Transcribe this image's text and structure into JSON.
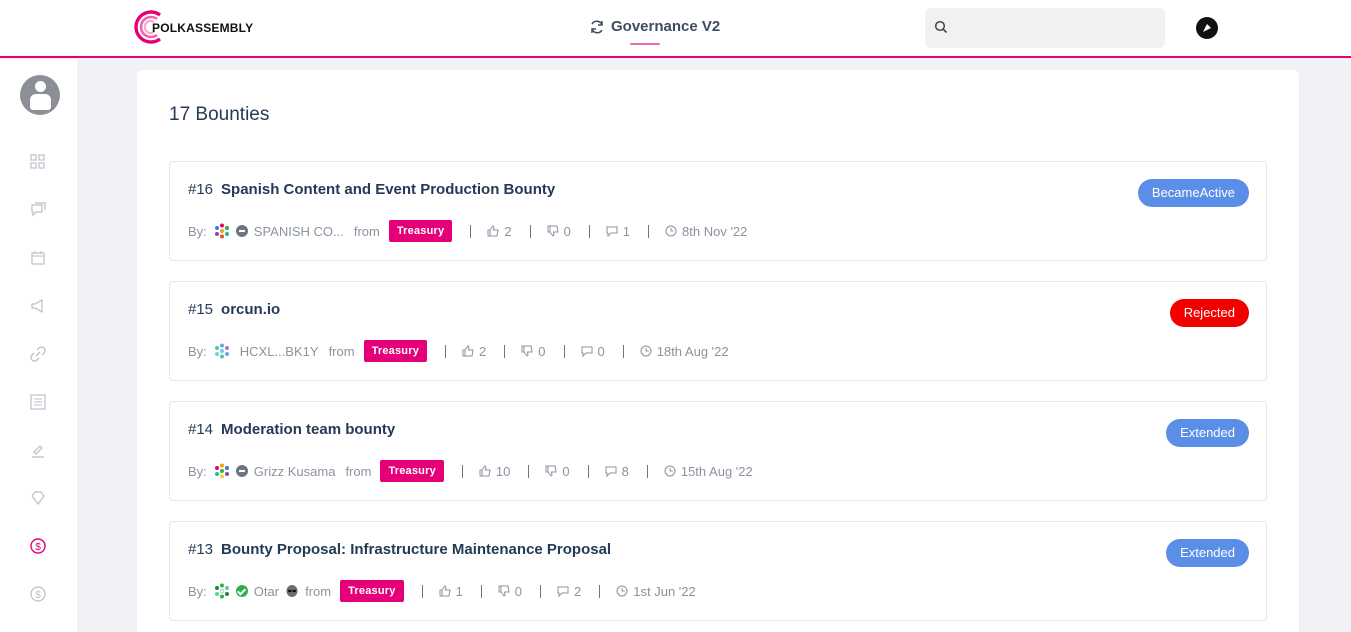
{
  "header": {
    "logo_text": "POLKASSEMBLY",
    "network_label": "Governance V2",
    "search_placeholder": ""
  },
  "sidebar": {
    "items": [
      {
        "icon": "grid-icon"
      },
      {
        "icon": "discussions-icon"
      },
      {
        "icon": "calendar-icon"
      },
      {
        "icon": "megaphone-icon"
      },
      {
        "icon": "link-icon"
      },
      {
        "icon": "list-icon"
      },
      {
        "icon": "gavel-icon"
      },
      {
        "icon": "diamond-icon"
      },
      {
        "icon": "bounty-icon",
        "active": true
      },
      {
        "icon": "child-bounty-icon"
      }
    ]
  },
  "main": {
    "count_title": "17 Bounties",
    "labels": {
      "by": "By:",
      "from": "from"
    },
    "bounties": [
      {
        "number": "#16",
        "title": "Spanish Content and Event Production Bounty",
        "status": "BecameActive",
        "status_color": "#5b8ee6",
        "author": "SPANISH CO...",
        "source": "Treasury",
        "likes": "2",
        "dislikes": "0",
        "comments": "1",
        "date": "8th Nov '22",
        "verified": "grey"
      },
      {
        "number": "#15",
        "title": "orcun.io",
        "status": "Rejected",
        "status_color": "#f20000",
        "author": "HCXL...BK1Y",
        "source": "Treasury",
        "likes": "2",
        "dislikes": "0",
        "comments": "0",
        "date": "18th Aug '22",
        "verified": "none"
      },
      {
        "number": "#14",
        "title": "Moderation team bounty",
        "status": "Extended",
        "status_color": "#5b8ee6",
        "author": "Grizz Kusama",
        "source": "Treasury",
        "likes": "10",
        "dislikes": "0",
        "comments": "8",
        "date": "15th Aug '22",
        "verified": "grey"
      },
      {
        "number": "#13",
        "title": "Bounty Proposal: Infrastructure Maintenance Proposal",
        "status": "Extended",
        "status_color": "#5b8ee6",
        "author": "Otar",
        "source": "Treasury",
        "likes": "1",
        "dislikes": "0",
        "comments": "2",
        "date": "1st Jun '22",
        "verified": "green"
      }
    ]
  },
  "colors": {
    "accent": "#e5007a",
    "status_blue": "#5b8ee6",
    "status_red": "#f20000"
  }
}
